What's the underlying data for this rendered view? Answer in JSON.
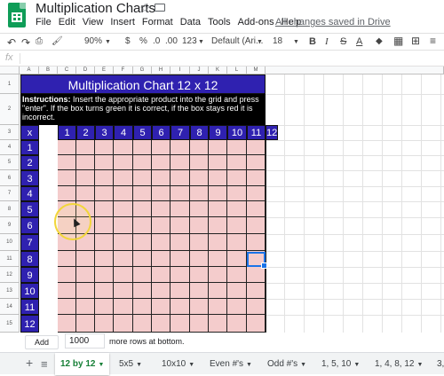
{
  "app": {
    "title": "Multiplication Charts",
    "menu": [
      "File",
      "Edit",
      "View",
      "Insert",
      "Format",
      "Data",
      "Tools",
      "Add-ons",
      "Help"
    ],
    "save_status": "All changes saved in Drive"
  },
  "toolbar": {
    "zoom": "90%",
    "currency": "$",
    "percent": "%",
    "decimal_less": ".0",
    "decimal_more": ".00",
    "more_formats": "123",
    "font": "Default (Ari...",
    "font_size": "18",
    "bold": "B",
    "italic": "I",
    "strikethrough": "S",
    "text_color": "A"
  },
  "formula_bar": {
    "label": "fx",
    "value": ""
  },
  "columns": [
    "A",
    "B",
    "C",
    "D",
    "E",
    "F",
    "G",
    "H",
    "I",
    "J",
    "K",
    "L",
    "M"
  ],
  "rows": [
    "1",
    "2",
    "3",
    "4",
    "5",
    "6",
    "7",
    "8",
    "9",
    "10",
    "11",
    "12",
    "13",
    "14",
    "15"
  ],
  "sheet": {
    "title": "Multiplication Chart 12 x 12",
    "instructions_label": "Instructions:",
    "instructions_text": " Insert the appropriate product into the grid and press \"enter\". If the box turns green it is correct, if the box stays red it is incorrect.",
    "corner_label": "x",
    "header_numbers": [
      "1",
      "2",
      "3",
      "4",
      "5",
      "6",
      "7",
      "8",
      "9",
      "10",
      "11",
      "12"
    ],
    "row_numbers": [
      "1",
      "2",
      "3",
      "4",
      "5",
      "6",
      "7",
      "8",
      "9",
      "10",
      "11",
      "12"
    ],
    "header_color": "#2f21b0",
    "cell_color": "#f4cccc"
  },
  "add_rows": {
    "button": "Add",
    "count": "1000",
    "suffix": "more rows at bottom."
  },
  "tabs": [
    {
      "label": "12 by 12",
      "active": true
    },
    {
      "label": "5x5",
      "active": false
    },
    {
      "label": "10x10",
      "active": false
    },
    {
      "label": "Even #'s",
      "active": false
    },
    {
      "label": "Odd #'s",
      "active": false
    },
    {
      "label": "1, 5, 10",
      "active": false
    },
    {
      "label": "1, 4, 8, 12",
      "active": false
    },
    {
      "label": "3,",
      "active": false
    }
  ]
}
